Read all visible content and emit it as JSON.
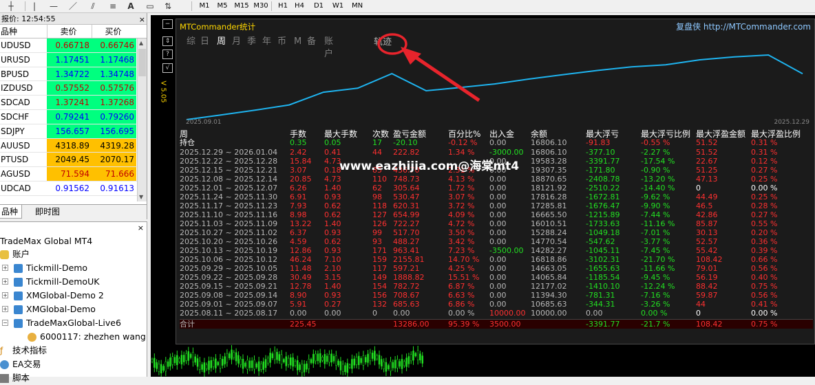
{
  "toolbar": {
    "timeframes": [
      "M1",
      "M5",
      "M15",
      "M30",
      "H1",
      "H4",
      "D1",
      "W1",
      "MN"
    ]
  },
  "market_watch": {
    "title": "报价: 12:54:55",
    "col_symbol": "品种",
    "col_bid": "卖价",
    "col_ask": "买价",
    "rows": [
      {
        "symbol": "UDUSD",
        "bid": "0.66718",
        "ask": "0.66746",
        "bg": "#00ff7f",
        "color": "#c00000"
      },
      {
        "symbol": "URUSD",
        "bid": "1.17451",
        "ask": "1.17468",
        "bg": "#00ff7f",
        "color": "#0000ff"
      },
      {
        "symbol": "BPUSD",
        "bid": "1.34722",
        "ask": "1.34748",
        "bg": "#00ff7f",
        "color": "#0000ff"
      },
      {
        "symbol": "IZDUSD",
        "bid": "0.57552",
        "ask": "0.57576",
        "bg": "#00ff7f",
        "color": "#c00000"
      },
      {
        "symbol": "SDCAD",
        "bid": "1.37241",
        "ask": "1.37268",
        "bg": "#00ff7f",
        "color": "#c00000"
      },
      {
        "symbol": "SDCHF",
        "bid": "0.79241",
        "ask": "0.79260",
        "bg": "#00ff7f",
        "color": "#0000ff"
      },
      {
        "symbol": "SDJPY",
        "bid": "156.657",
        "ask": "156.695",
        "bg": "#00ff7f",
        "color": "#0000ff"
      },
      {
        "symbol": "AUUSD",
        "bid": "4318.89",
        "ask": "4319.28",
        "bg": "#ffc000",
        "color": "#000000"
      },
      {
        "symbol": "PTUSD",
        "bid": "2049.45",
        "ask": "2070.17",
        "bg": "#ffc000",
        "color": "#000000"
      },
      {
        "symbol": "AGUSD",
        "bid": "71.594",
        "ask": "71.666",
        "bg": "#ffc000",
        "color": "#c00000"
      },
      {
        "symbol": "UDCAD",
        "bid": "0.91562",
        "ask": "0.91613",
        "bg": "#ffffff",
        "color": "#0000ff"
      }
    ],
    "tab_symbols": "品种",
    "tab_tick": "即时图"
  },
  "navigator": {
    "root": "TradeMax Global MT4",
    "accounts": "账户",
    "items": [
      "Tickmill-Demo",
      "Tickmill-DemoUK",
      "XMGlobal-Demo 2",
      "XMGlobal-Demo",
      "TradeMaxGlobal-Live6"
    ],
    "account_user": "6000117: zhezhen wang",
    "indicators": "技术指标",
    "ea": "EA交易",
    "scripts": "脚本"
  },
  "panel": {
    "title": "MTCommander统计",
    "site": "复盘侠 http://MTCommander.com",
    "tabs": [
      "综",
      "日",
      "周",
      "月",
      "季",
      "年",
      "币",
      "M",
      "备",
      "账户"
    ],
    "selected_tab": "周",
    "extra_label": "轨迹",
    "version": "V 5.05",
    "graph_start": "2025.09.01",
    "graph_end": "2025.12.29",
    "headers": [
      "周",
      "手数",
      "最大手数",
      "次数",
      "盈亏金额",
      "百分比%",
      "出入金",
      "余额",
      "最大浮亏",
      "最大浮亏比例",
      "最大浮盈金额",
      "最大浮盈比例"
    ],
    "holding": {
      "label": "持仓",
      "lots": "0.35",
      "maxlots": "0.05",
      "count": "17",
      "pnl": "-20.10",
      "pct": "-0.12 %",
      "flow": "0.00",
      "balance": "16806.10",
      "maxdd": "-91.83",
      "ddpct": "-0.55 %",
      "maxfp": "51.52",
      "fppct": "0.31 %"
    },
    "rows": [
      [
        "2025.12.29 ~ 2026.01.04",
        "2.42",
        "0.41",
        "44",
        "222.82",
        "1.34 %",
        "-3000.00",
        "16806.10",
        "-377.10",
        "-2.27 %",
        "51.52",
        "0.31 %"
      ],
      [
        "2025.12.22 ~ 2025.12.28",
        "15.84",
        "4.73",
        "",
        "",
        "",
        "0.00",
        "19583.28",
        "-3391.77",
        "-17.54 %",
        "22.67",
        "0.12 %"
      ],
      [
        "2025.12.15 ~ 2025.12.21",
        "3.07",
        "0.18",
        "85",
        "436.70",
        "2.31 %",
        "0.00",
        "19307.35",
        "-171.80",
        "-0.90 %",
        "51.25",
        "0.27 %"
      ],
      [
        "2025.12.08 ~ 2025.12.14",
        "20.85",
        "4.73",
        "110",
        "748.73",
        "4.13 %",
        "0.00",
        "18870.65",
        "-2408.78",
        "-13.20 %",
        "47.13",
        "0.25 %"
      ],
      [
        "2025.12.01 ~ 2025.12.07",
        "6.26",
        "1.40",
        "62",
        "305.64",
        "1.72 %",
        "0.00",
        "18121.92",
        "-2510.22",
        "-14.40 %",
        "0",
        "0.00 %"
      ],
      [
        "2025.11.24 ~ 2025.11.30",
        "6.91",
        "0.93",
        "98",
        "530.47",
        "3.07 %",
        "0.00",
        "17816.28",
        "-1672.81",
        "-9.62 %",
        "44.49",
        "0.25 %"
      ],
      [
        "2025.11.17 ~ 2025.11.23",
        "7.93",
        "0.62",
        "118",
        "620.31",
        "3.72 %",
        "0.00",
        "17285.81",
        "-1676.47",
        "-9.90 %",
        "46.5",
        "0.28 %"
      ],
      [
        "2025.11.10 ~ 2025.11.16",
        "8.98",
        "0.62",
        "127",
        "654.99",
        "4.09 %",
        "0.00",
        "16665.50",
        "-1215.89",
        "-7.44 %",
        "42.86",
        "0.27 %"
      ],
      [
        "2025.11.03 ~ 2025.11.09",
        "13.22",
        "1.40",
        "126",
        "722.27",
        "4.72 %",
        "0.00",
        "16010.51",
        "-1733.63",
        "-11.16 %",
        "85.87",
        "0.55 %"
      ],
      [
        "2025.10.27 ~ 2025.11.02",
        "6.37",
        "0.93",
        "99",
        "517.70",
        "3.50 %",
        "0.00",
        "15288.24",
        "-1049.18",
        "-7.01 %",
        "30.13",
        "0.20 %"
      ],
      [
        "2025.10.20 ~ 2025.10.26",
        "4.59",
        "0.62",
        "93",
        "488.27",
        "3.42 %",
        "0.00",
        "14770.54",
        "-547.62",
        "-3.77 %",
        "52.57",
        "0.36 %"
      ],
      [
        "2025.10.13 ~ 2025.10.19",
        "12.86",
        "0.93",
        "171",
        "963.41",
        "7.23 %",
        "-3500.00",
        "14282.27",
        "-1045.11",
        "-7.45 %",
        "55.42",
        "0.39 %"
      ],
      [
        "2025.10.06 ~ 2025.10.12",
        "46.24",
        "7.10",
        "159",
        "2155.81",
        "14.70 %",
        "0.00",
        "16818.86",
        "-3102.31",
        "-21.70 %",
        "108.42",
        "0.66 %"
      ],
      [
        "2025.09.29 ~ 2025.10.05",
        "11.48",
        "2.10",
        "117",
        "597.21",
        "4.25 %",
        "0.00",
        "14663.05",
        "-1655.63",
        "-11.66 %",
        "79.01",
        "0.56 %"
      ],
      [
        "2025.09.22 ~ 2025.09.28",
        "30.49",
        "3.15",
        "149",
        "1888.82",
        "15.51 %",
        "0.00",
        "14065.84",
        "-1185.54",
        "-9.45 %",
        "56.19",
        "0.40 %"
      ],
      [
        "2025.09.15 ~ 2025.09.21",
        "12.78",
        "1.40",
        "154",
        "782.72",
        "6.87 %",
        "0.00",
        "12177.02",
        "-1410.10",
        "-12.24 %",
        "88.42",
        "0.75 %"
      ],
      [
        "2025.09.08 ~ 2025.09.14",
        "8.90",
        "0.93",
        "156",
        "708.67",
        "6.63 %",
        "0.00",
        "11394.30",
        "-781.31",
        "-7.16 %",
        "59.87",
        "0.56 %"
      ],
      [
        "2025.09.01 ~ 2025.09.07",
        "5.91",
        "0.27",
        "132",
        "685.63",
        "6.86 %",
        "0.00",
        "10685.63",
        "-344.31",
        "-3.26 %",
        "44",
        "0.41 %"
      ],
      [
        "2025.08.11 ~ 2025.08.17",
        "0.00",
        "0.00",
        "0",
        "0.00",
        "0.00 %",
        "10000.00",
        "10000.00",
        "0.00",
        "0.00 %",
        "0",
        "0.00 %"
      ]
    ],
    "total": {
      "label": "合计",
      "lots": "225.45",
      "pnl": "13286.00",
      "pct": "95.39 %",
      "flow": "3500.00",
      "maxdd": "-3391.77",
      "ddpct": "-21.7 %",
      "maxfp": "108.42",
      "fppct": "0.75 %"
    }
  },
  "watermark": "www.eazhijia.com@海棠mt4",
  "equity_series": [
    10000,
    10685.63,
    11394.3,
    12177.02,
    14065.84,
    14663.05,
    16818.86,
    14282.27,
    14770.54,
    15288.24,
    16010.51,
    16665.5,
    17285.81,
    17816.28,
    18121.92,
    18870.65,
    19307.35,
    19583.28,
    16806.1
  ]
}
